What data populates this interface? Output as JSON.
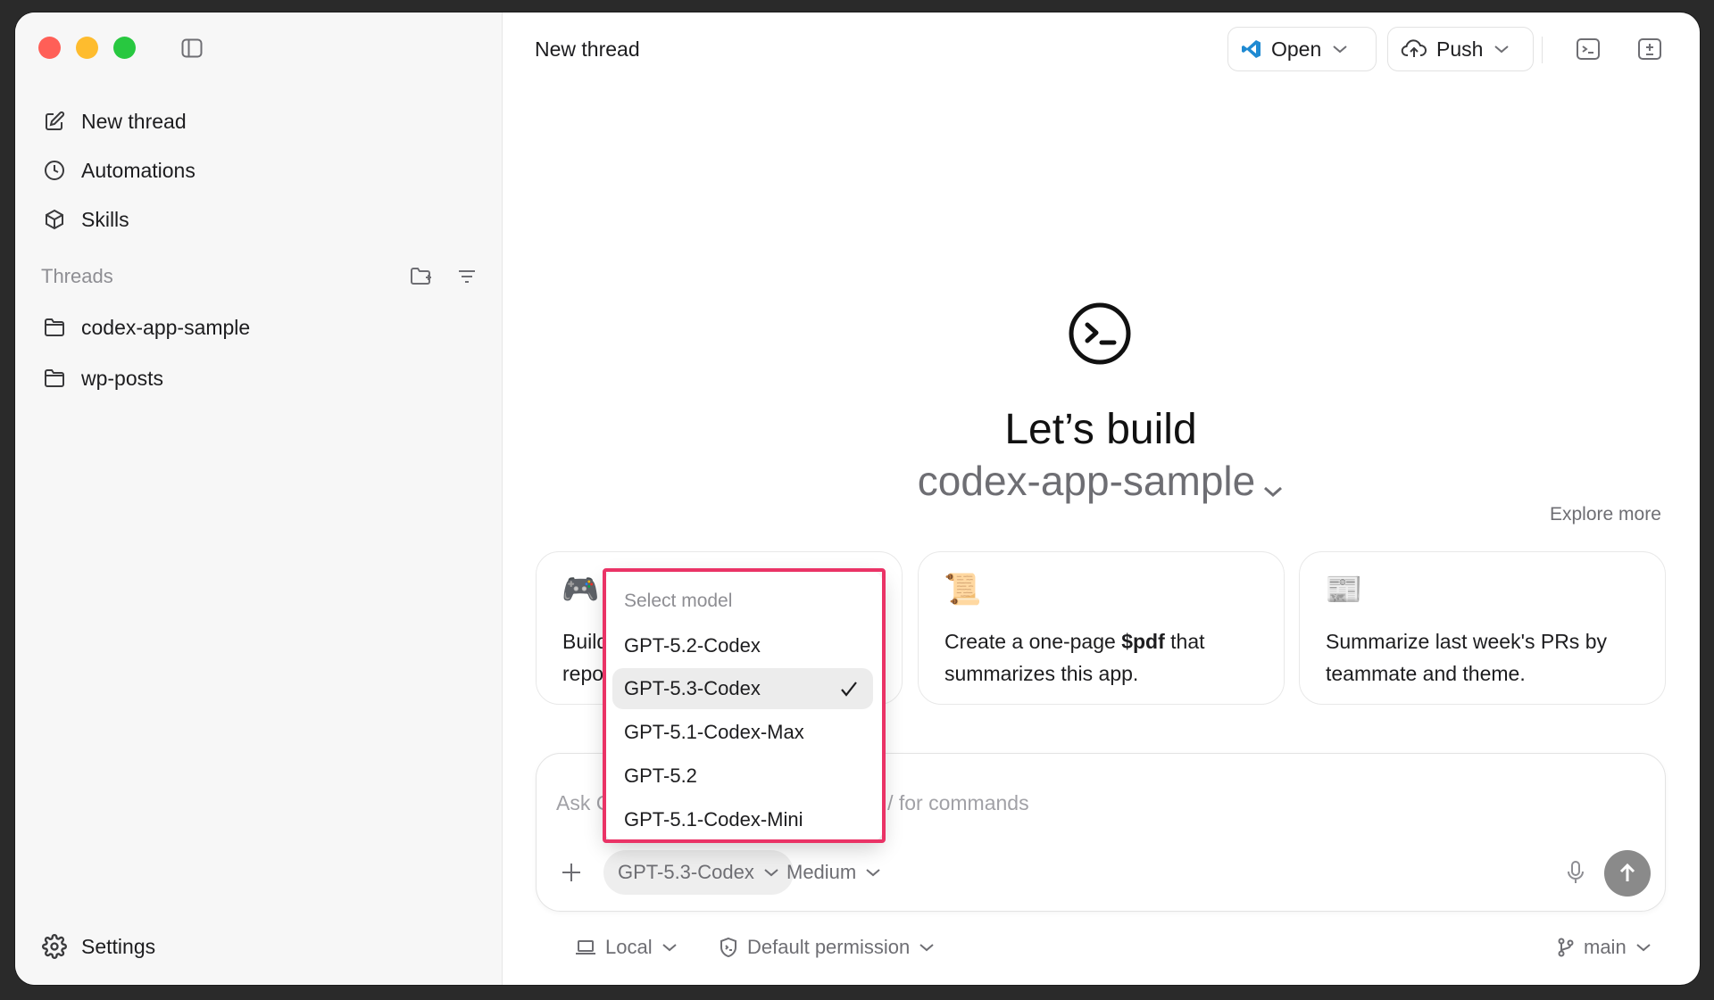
{
  "sidebar": {
    "nav": [
      {
        "label": "New thread",
        "icon": "pencil-square-icon"
      },
      {
        "label": "Automations",
        "icon": "clock-icon"
      },
      {
        "label": "Skills",
        "icon": "cube-icon"
      }
    ],
    "section_title": "Threads",
    "threads": [
      {
        "label": "codex-app-sample",
        "icon": "folder-icon"
      },
      {
        "label": "wp-posts",
        "icon": "folder-icon"
      }
    ],
    "settings_label": "Settings"
  },
  "header": {
    "title": "New thread",
    "open_label": "Open",
    "push_label": "Push"
  },
  "hero": {
    "title": "Let’s build",
    "project": "codex-app-sample",
    "explore_label": "Explore more"
  },
  "cards": [
    {
      "emoji": "🎮",
      "text": "Build a classic Snake game in this repo."
    },
    {
      "emoji": "📜",
      "text_pre": "Create a one-page ",
      "text_bold": "$pdf",
      "text_post": " that summarizes this app."
    },
    {
      "emoji": "📰",
      "text": "Summarize last week's PRs by teammate and theme."
    }
  ],
  "composer": {
    "placeholder": "Ask Codex anything, @ to add files, / for commands",
    "model": "GPT-5.3-Codex",
    "effort": "Medium"
  },
  "footer": {
    "environment": "Local",
    "permission": "Default permission",
    "branch": "main"
  },
  "model_menu": {
    "header": "Select model",
    "options": [
      "GPT-5.2-Codex",
      "GPT-5.3-Codex",
      "GPT-5.1-Codex-Max",
      "GPT-5.2",
      "GPT-5.1-Codex-Mini"
    ],
    "selected": "GPT-5.3-Codex"
  },
  "colors": {
    "highlight_outline": "#ea3366",
    "send_button": "#8a8a8a"
  }
}
